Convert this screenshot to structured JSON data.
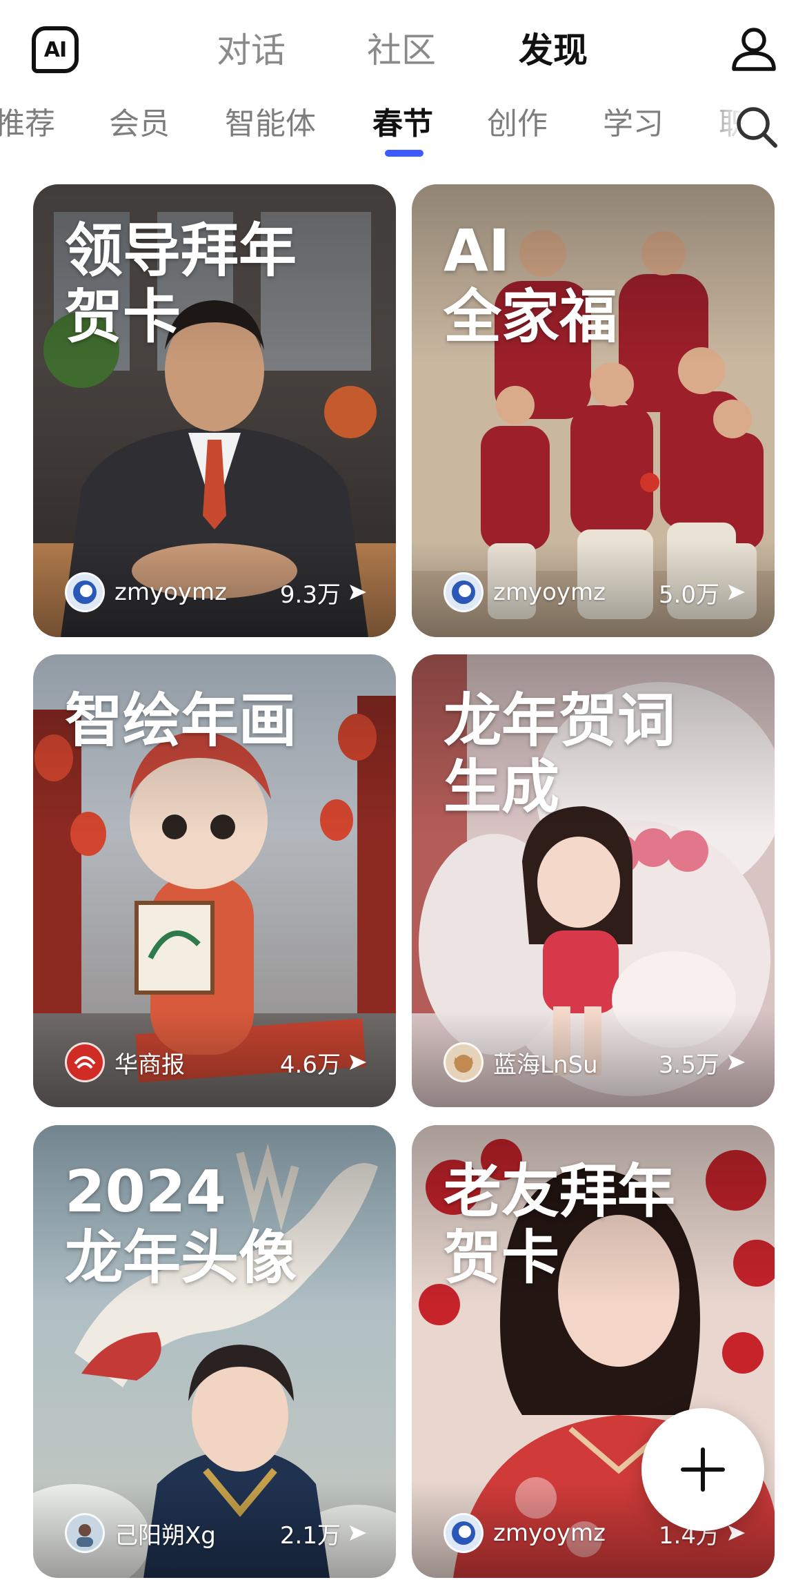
{
  "header": {
    "logo_text": "AI",
    "tabs": [
      {
        "label": "对话"
      },
      {
        "label": "社区"
      },
      {
        "label": "发现"
      }
    ],
    "active_tab": "发现"
  },
  "categories": {
    "tabs": [
      {
        "label": "推荐"
      },
      {
        "label": "会员"
      },
      {
        "label": "智能体"
      },
      {
        "label": "春节"
      },
      {
        "label": "创作"
      },
      {
        "label": "学习"
      },
      {
        "label": "职"
      }
    ],
    "active": "春节"
  },
  "cards": [
    {
      "title": "领导拜年\n贺卡",
      "author": "zmyoymz",
      "count": "9.3万"
    },
    {
      "title": "AI\n全家福",
      "author": "zmyoymz",
      "count": "5.0万"
    },
    {
      "title": "智绘年画",
      "author": "华商报",
      "count": "4.6万"
    },
    {
      "title": "龙年贺词\n生成",
      "author": "蓝海LnSu",
      "count": "3.5万"
    },
    {
      "title": "2024\n龙年头像",
      "author": "己阳朔Xg",
      "count": "2.1万"
    },
    {
      "title": "老友拜年\n贺卡",
      "author": "zmyoymz",
      "count": "1.4万"
    }
  ],
  "colors": {
    "accent": "#3d5afe",
    "active_text": "#111111",
    "inactive_text": "#8a8a8a"
  },
  "icons": {
    "user": "user-icon",
    "search": "search-icon",
    "share": "share-arrow-icon",
    "add": "plus-icon"
  }
}
